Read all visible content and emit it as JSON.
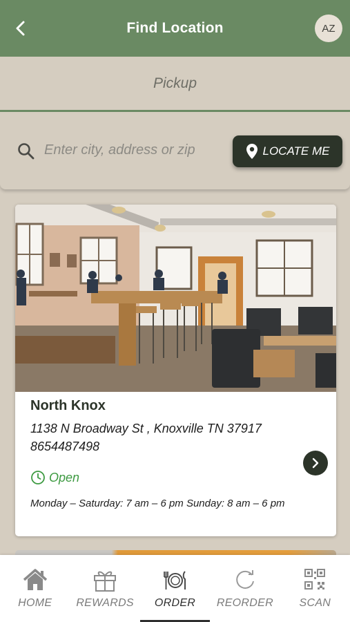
{
  "header": {
    "title": "Find Location",
    "avatar_initials": "AZ"
  },
  "mode": {
    "label": "Pickup"
  },
  "search": {
    "placeholder": "Enter city, address or zip",
    "value": "",
    "locate_label": "LOCATE ME"
  },
  "locations": [
    {
      "name": "North Knox",
      "address": "1138 N Broadway St , Knoxville TN 37917",
      "phone": "8654487498",
      "status": "Open",
      "hours": "Monday – Saturday: 7 am – 6 pm Sunday: 8 am – 6 pm"
    }
  ],
  "nav": {
    "items": [
      {
        "label": "HOME",
        "icon": "home-icon"
      },
      {
        "label": "REWARDS",
        "icon": "gift-icon"
      },
      {
        "label": "ORDER",
        "icon": "plate-cutlery-icon",
        "active": true
      },
      {
        "label": "REORDER",
        "icon": "refresh-icon"
      },
      {
        "label": "SCAN",
        "icon": "qr-code-icon"
      }
    ]
  },
  "colors": {
    "header_green": "#6a8a63",
    "background": "#d5cdc0",
    "dark_button": "#2c3429",
    "open_green": "#3d9a41"
  }
}
